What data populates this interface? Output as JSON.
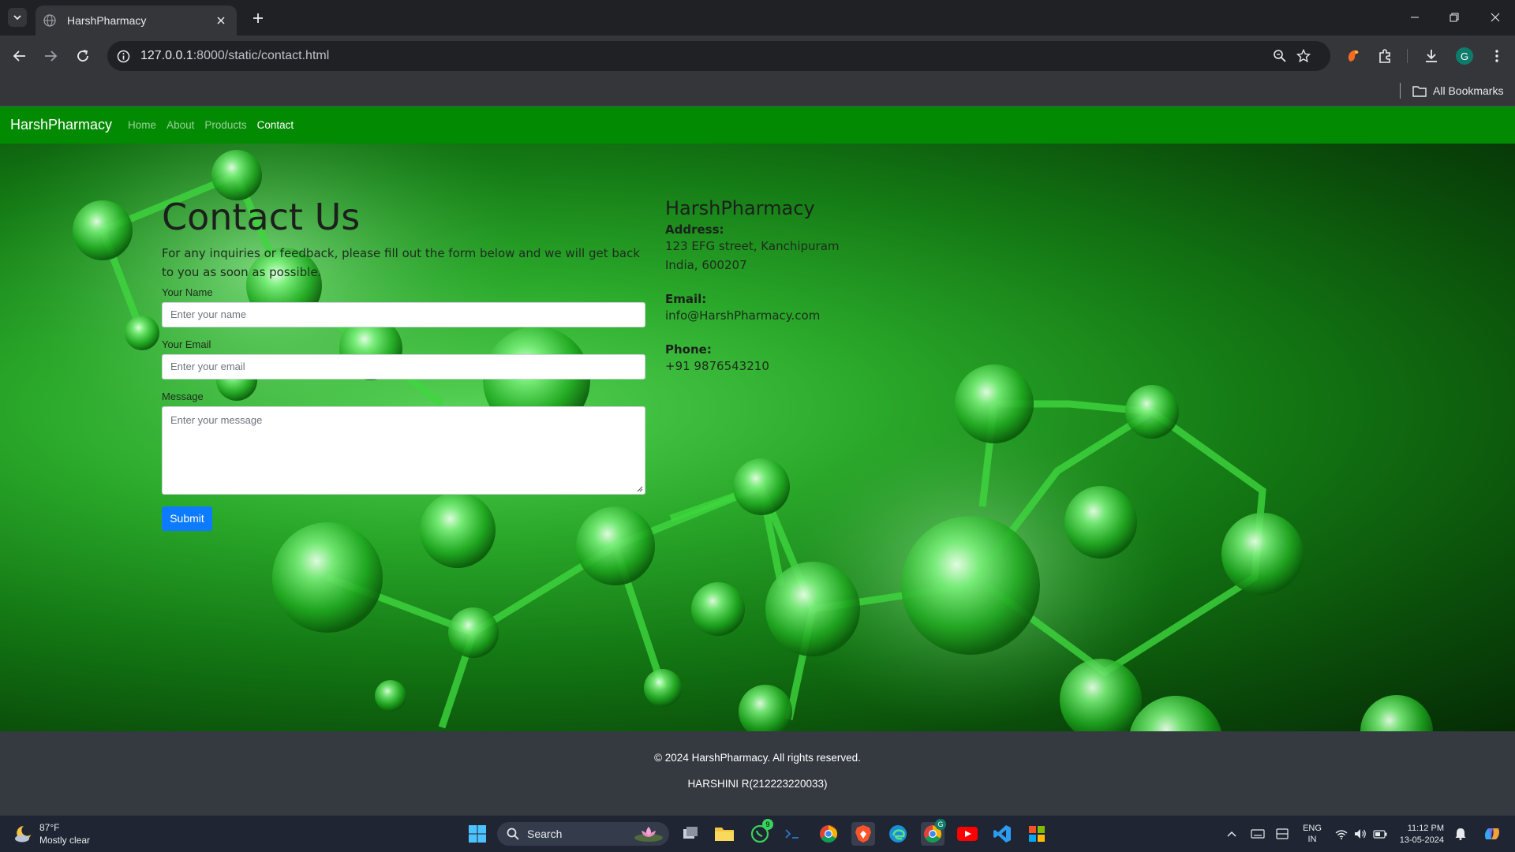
{
  "browser": {
    "tab_title": "HarshPharmacy",
    "url_host": "127.0.0.1",
    "url_path": ":8000/static/contact.html",
    "bookmarks_label": "All Bookmarks",
    "profile_initial": "G"
  },
  "site": {
    "brand": "HarshPharmacy",
    "nav": [
      {
        "label": "Home",
        "active": false
      },
      {
        "label": "About",
        "active": false
      },
      {
        "label": "Products",
        "active": false
      },
      {
        "label": "Contact",
        "active": true
      }
    ],
    "accent_color": "#028a02"
  },
  "contact": {
    "title": "Contact Us",
    "intro": "For any inquiries or feedback, please fill out the form below and we will get back to you as soon as possible.",
    "name_label": "Your Name",
    "name_placeholder": "Enter your name",
    "email_label": "Your Email",
    "email_placeholder": "Enter your email",
    "message_label": "Message",
    "message_placeholder": "Enter your message",
    "submit_label": "Submit",
    "submit_color": "#0d7bff"
  },
  "info": {
    "title": "HarshPharmacy",
    "address_label": "Address:",
    "address_line1": "123 EFG street, Kanchipuram",
    "address_line2": "India, 600207",
    "email_label": "Email:",
    "email_value": "info@HarshPharmacy.com",
    "phone_label": "Phone:",
    "phone_value": "+91 9876543210"
  },
  "footer": {
    "copyright": "© 2024 HarshPharmacy. All rights reserved.",
    "author": "HARSHINI R(212223220033)"
  },
  "taskbar": {
    "temperature": "87°F",
    "weather": "Mostly clear",
    "search_label": "Search",
    "whatsapp_badge": "9",
    "chrome_badge": "G",
    "lang_line1": "ENG",
    "lang_line2": "IN",
    "time": "11:12 PM",
    "date": "13-05-2024"
  }
}
